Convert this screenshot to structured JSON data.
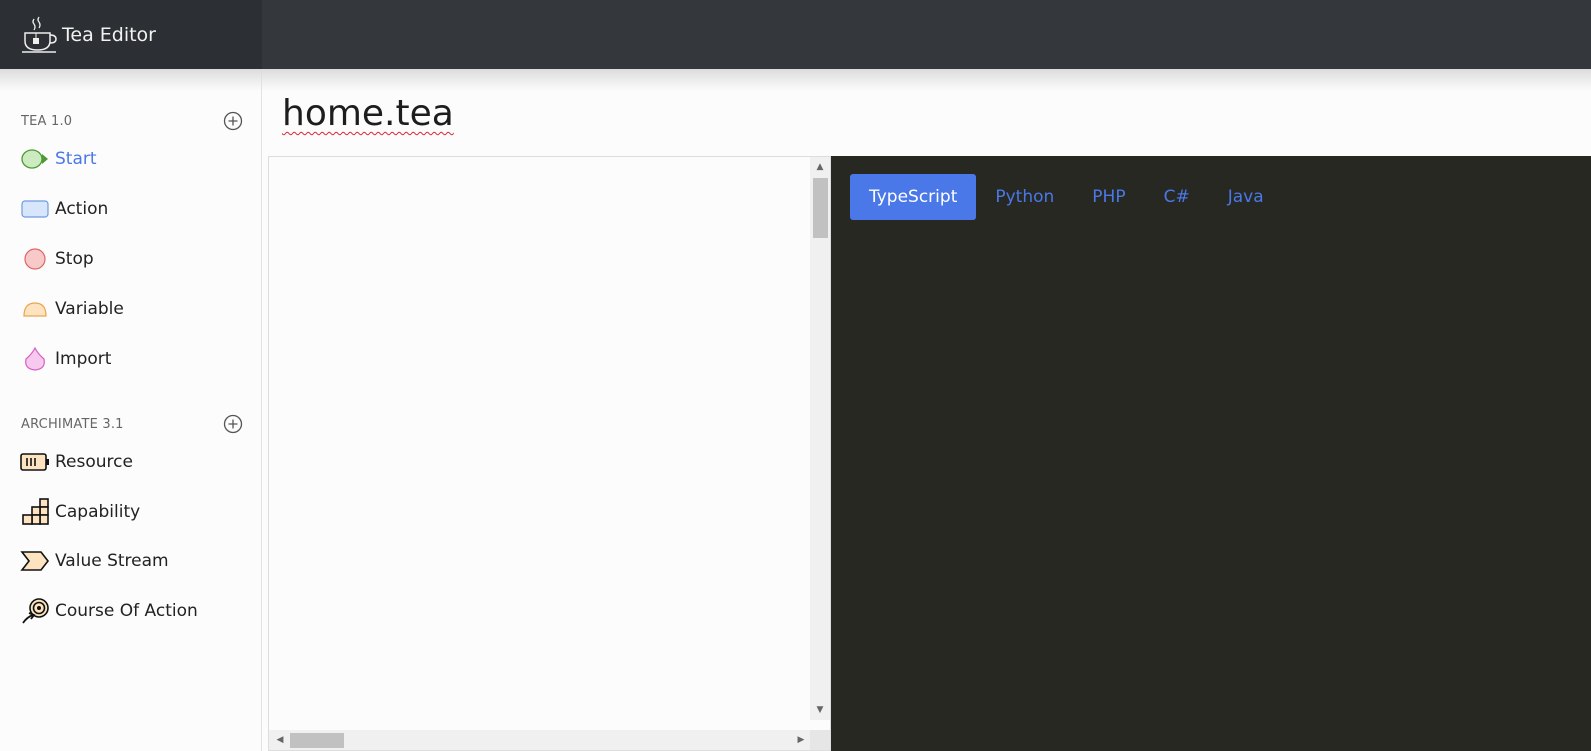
{
  "app": {
    "title": "Tea Editor"
  },
  "sidebar": {
    "sections": [
      {
        "label": "TEA 1.0",
        "items": [
          {
            "label": "Start",
            "icon": "start-node-icon",
            "active": true
          },
          {
            "label": "Action",
            "icon": "action-node-icon"
          },
          {
            "label": "Stop",
            "icon": "stop-node-icon"
          },
          {
            "label": "Variable",
            "icon": "variable-node-icon"
          },
          {
            "label": "Import",
            "icon": "import-node-icon"
          }
        ]
      },
      {
        "label": "ARCHIMATE 3.1",
        "items": [
          {
            "label": "Resource",
            "icon": "resource-icon"
          },
          {
            "label": "Capability",
            "icon": "capability-icon"
          },
          {
            "label": "Value Stream",
            "icon": "value-stream-icon"
          },
          {
            "label": "Course Of Action",
            "icon": "course-of-action-icon"
          }
        ]
      }
    ]
  },
  "document": {
    "filename": "home.tea"
  },
  "code": {
    "tabs": [
      "TypeScript",
      "Python",
      "PHP",
      "C#",
      "Java"
    ],
    "active_tab": "TypeScript"
  },
  "colors": {
    "accent": "#4a78e8",
    "header_bg": "#2c2f33",
    "code_bg": "#272822"
  }
}
